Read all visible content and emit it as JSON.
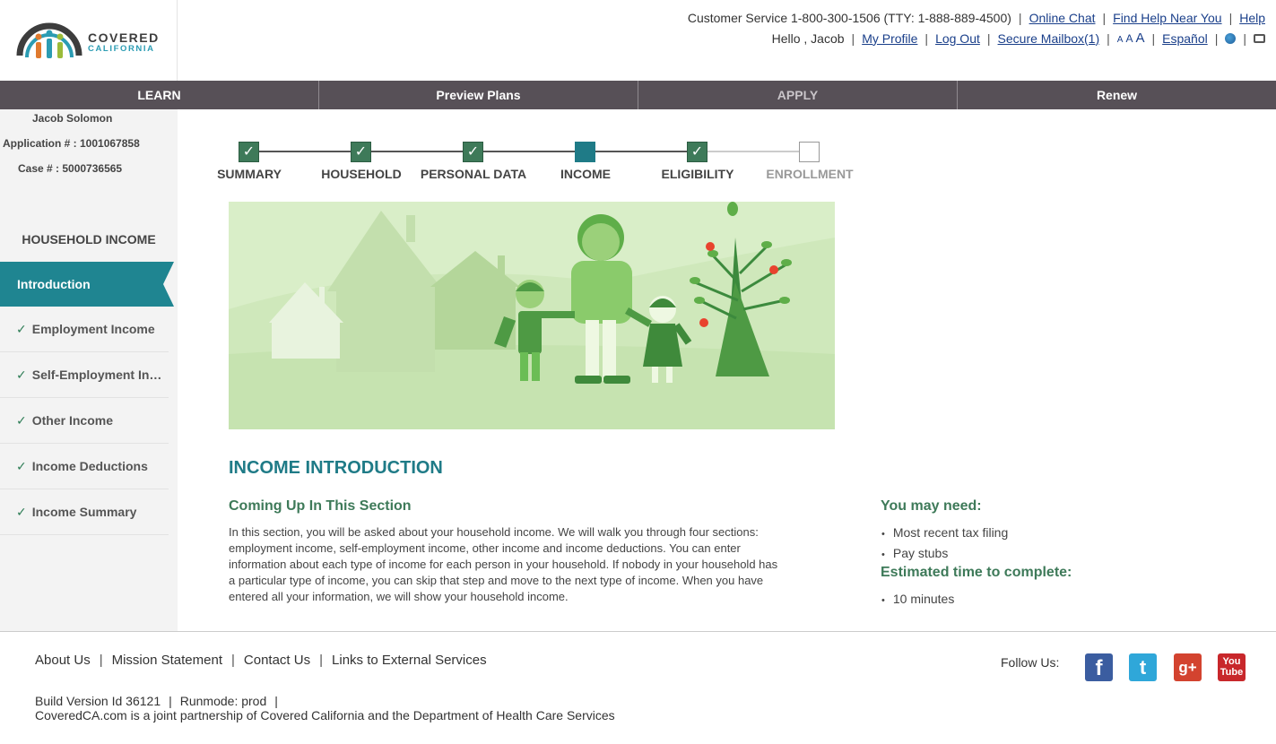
{
  "brand": {
    "line1": "COVERED",
    "line2": "CALIFORNIA"
  },
  "header": {
    "customer_service": "Customer Service 1-800-300-1506 (TTY: 1-888-889-4500)",
    "online_chat": "Online Chat",
    "find_help": "Find Help Near You",
    "help": "Help",
    "greeting": "Hello , Jacob",
    "my_profile": "My Profile",
    "log_out": "Log Out",
    "secure_mailbox": "Secure Mailbox(1)",
    "text_size": [
      "A",
      "A",
      "A"
    ],
    "espanol": "Español",
    "icons": [
      "globe-icon",
      "printer-icon"
    ]
  },
  "nav": {
    "learn": "LEARN",
    "preview_plans": "Preview Plans",
    "apply": "APPLY",
    "renew": "Renew"
  },
  "sidebar": {
    "name": "Jacob Solomon",
    "application": "Application # : 1001067858",
    "case": "Case # : 5000736565",
    "heading": "HOUSEHOLD INCOME",
    "active_item": "Introduction",
    "items": [
      "Employment Income",
      "Self-Employment Income",
      "Other Income",
      "Income Deductions",
      "Income Summary"
    ]
  },
  "progress": {
    "steps": [
      {
        "label": "SUMMARY",
        "state": "done"
      },
      {
        "label": "HOUSEHOLD",
        "state": "done"
      },
      {
        "label": "PERSONAL DATA",
        "state": "done"
      },
      {
        "label": "INCOME",
        "state": "current"
      },
      {
        "label": "ELIGIBILITY",
        "state": "done"
      },
      {
        "label": "ENROLLMENT",
        "state": "pending"
      }
    ],
    "check": "✓"
  },
  "content": {
    "title": "INCOME INTRODUCTION",
    "coming_up_heading": "Coming Up In This Section",
    "coming_up_text": "In this section, you will be asked about your household income. We will walk you through four sections: employment income, self-employment income, other income and income deductions. You can enter information about each type of income for each person in your household. If nobody in your household has a particular type of income, you can skip that step and move to the next type of income. When you have entered all your information, we will show your household income.",
    "need_heading": "You may need:",
    "need_items": [
      "Most recent tax filing",
      "Pay stubs"
    ],
    "time_heading": "Estimated time to complete:",
    "time_items": [
      "10 minutes"
    ]
  },
  "footer": {
    "links": [
      "About Us",
      "Mission Statement",
      "Contact Us",
      "Links to External Services"
    ],
    "build_version": "Build Version Id 36121",
    "runmode": "Runmode: prod",
    "partnership": "CoveredCA.com is a joint partnership of Covered California and the Department of Health Care Services",
    "follow_us": "Follow Us:",
    "social": {
      "facebook": "f",
      "twitter": "t",
      "google_plus": "g+",
      "youtube_top": "You",
      "youtube_bottom": "Tube"
    }
  },
  "colors": {
    "nav_bg": "#575057",
    "teal": "#1f8591",
    "green": "#3e7a59"
  }
}
